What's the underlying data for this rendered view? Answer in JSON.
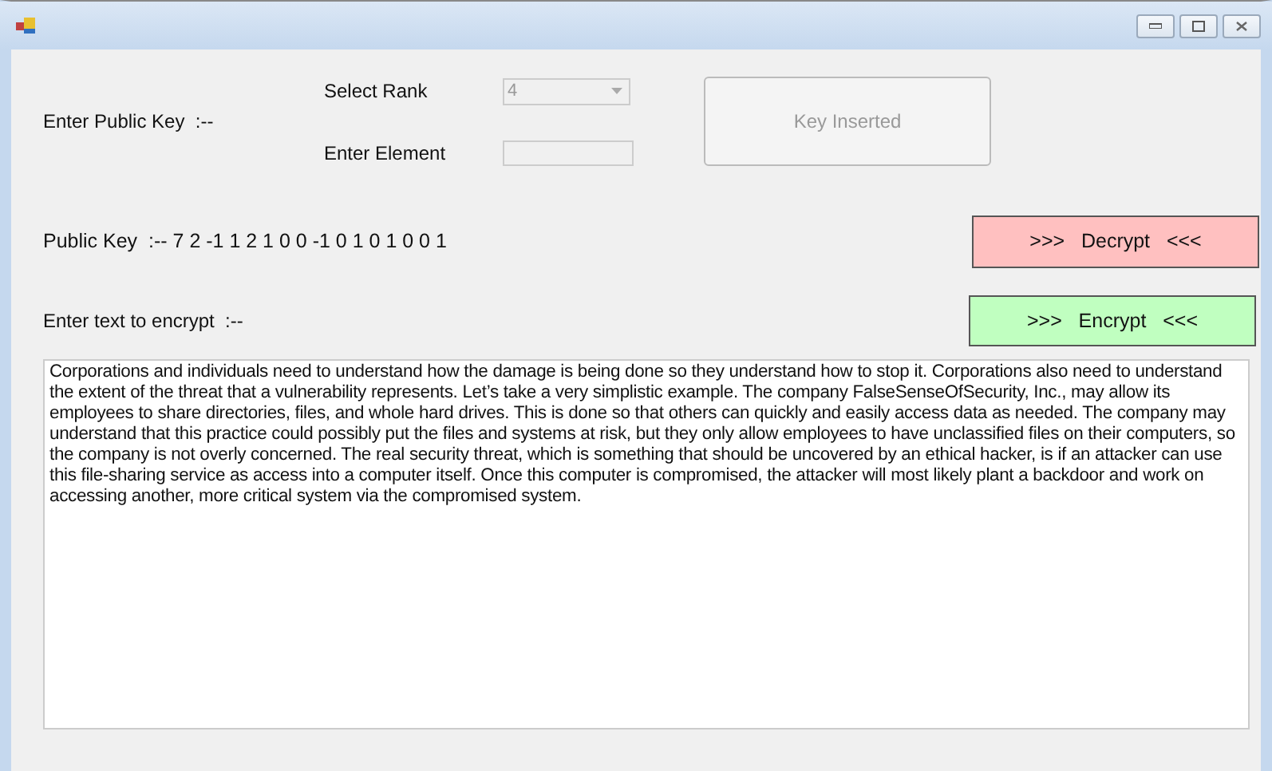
{
  "public_key_input": {
    "label": "Enter Public Key  :--"
  },
  "rank": {
    "label": "Select Rank",
    "value": "4",
    "disabled": true
  },
  "element": {
    "label": "Enter Element",
    "disabled": true
  },
  "key_button": {
    "label": "Key Inserted",
    "disabled": true
  },
  "public_key": {
    "label": "Public Key  :--",
    "value": "7 2 -1 1 2 1 0 0 -1 0 1 0 1 0 0 1"
  },
  "decrypt_button": {
    "label": ">>>   Decrypt   <<<"
  },
  "encrypt_label": "Enter text to encrypt  :--",
  "encrypt_button": {
    "label": ">>>   Encrypt   <<<"
  },
  "text_area": {
    "value": "Corporations and individuals need to understand how the damage is being done so they understand how to stop it. Corporations also need to understand the extent of the threat that a vulnerability represents. Let’s take a very simplistic example. The company FalseSenseOfSecurity, Inc., may allow its employees to share directories, files, and whole hard drives. This is done so that others can quickly and easily access data as needed. The company may understand that this practice could possibly put the files and systems at risk, but they only allow employees to have unclassified files on their computers, so the company is not overly concerned. The real security threat, which is something that should be uncovered by an ethical hacker, is if an attacker can use this file-sharing service as access into a computer itself. Once this computer is compromised, the attacker will most likely plant a backdoor and work on accessing another, more critical system via the compromised system."
  }
}
